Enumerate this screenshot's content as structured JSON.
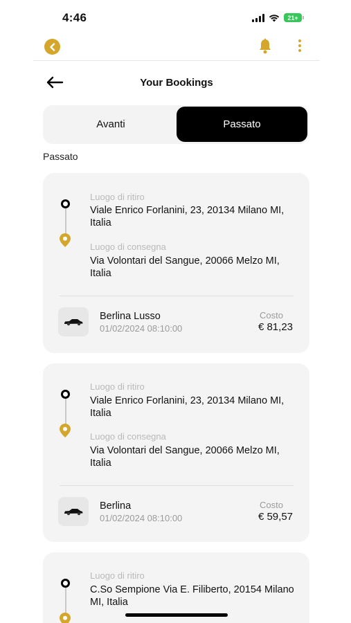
{
  "status": {
    "time": "4:46",
    "battery": "21+"
  },
  "colors": {
    "accent": "#d4a72c",
    "selected_tab": "#000000",
    "card_bg": "#f4f4f4"
  },
  "icons": {
    "back": "chevron-left-icon",
    "bell": "bell-icon",
    "more": "more-vertical-icon",
    "arrow": "arrow-left-icon",
    "car": "car-icon",
    "pickup": "start-dot-icon",
    "dropoff": "location-pin-icon"
  },
  "header": {
    "title": "Your Bookings"
  },
  "tabs": [
    {
      "label": "Avanti",
      "selected": false
    },
    {
      "label": "Passato",
      "selected": true
    }
  ],
  "section_label": "Passato",
  "bookings": [
    {
      "pickup_label": "Luogo di ritiro",
      "pickup_address": "Viale Enrico Forlanini, 23, 20134 Milano MI, Italia",
      "dropoff_label": "Luogo di consegna",
      "dropoff_address": "Via Volontari del Sangue, 20066 Melzo MI, Italia",
      "car": "Berlina Lusso",
      "datetime": "01/02/2024 08:10:00",
      "cost_label": "Costo",
      "cost": "€ 81,23"
    },
    {
      "pickup_label": "Luogo di ritiro",
      "pickup_address": "Viale Enrico Forlanini, 23, 20134 Milano MI, Italia",
      "dropoff_label": "Luogo di consegna",
      "dropoff_address": "Via Volontari del Sangue, 20066 Melzo MI, Italia",
      "car": "Berlina",
      "datetime": "01/02/2024 08:10:00",
      "cost_label": "Costo",
      "cost": "€ 59,57"
    },
    {
      "pickup_label": "Luogo di ritiro",
      "pickup_address": "C.So Sempione Via E. Filiberto, 20154 Milano MI, Italia"
    }
  ]
}
